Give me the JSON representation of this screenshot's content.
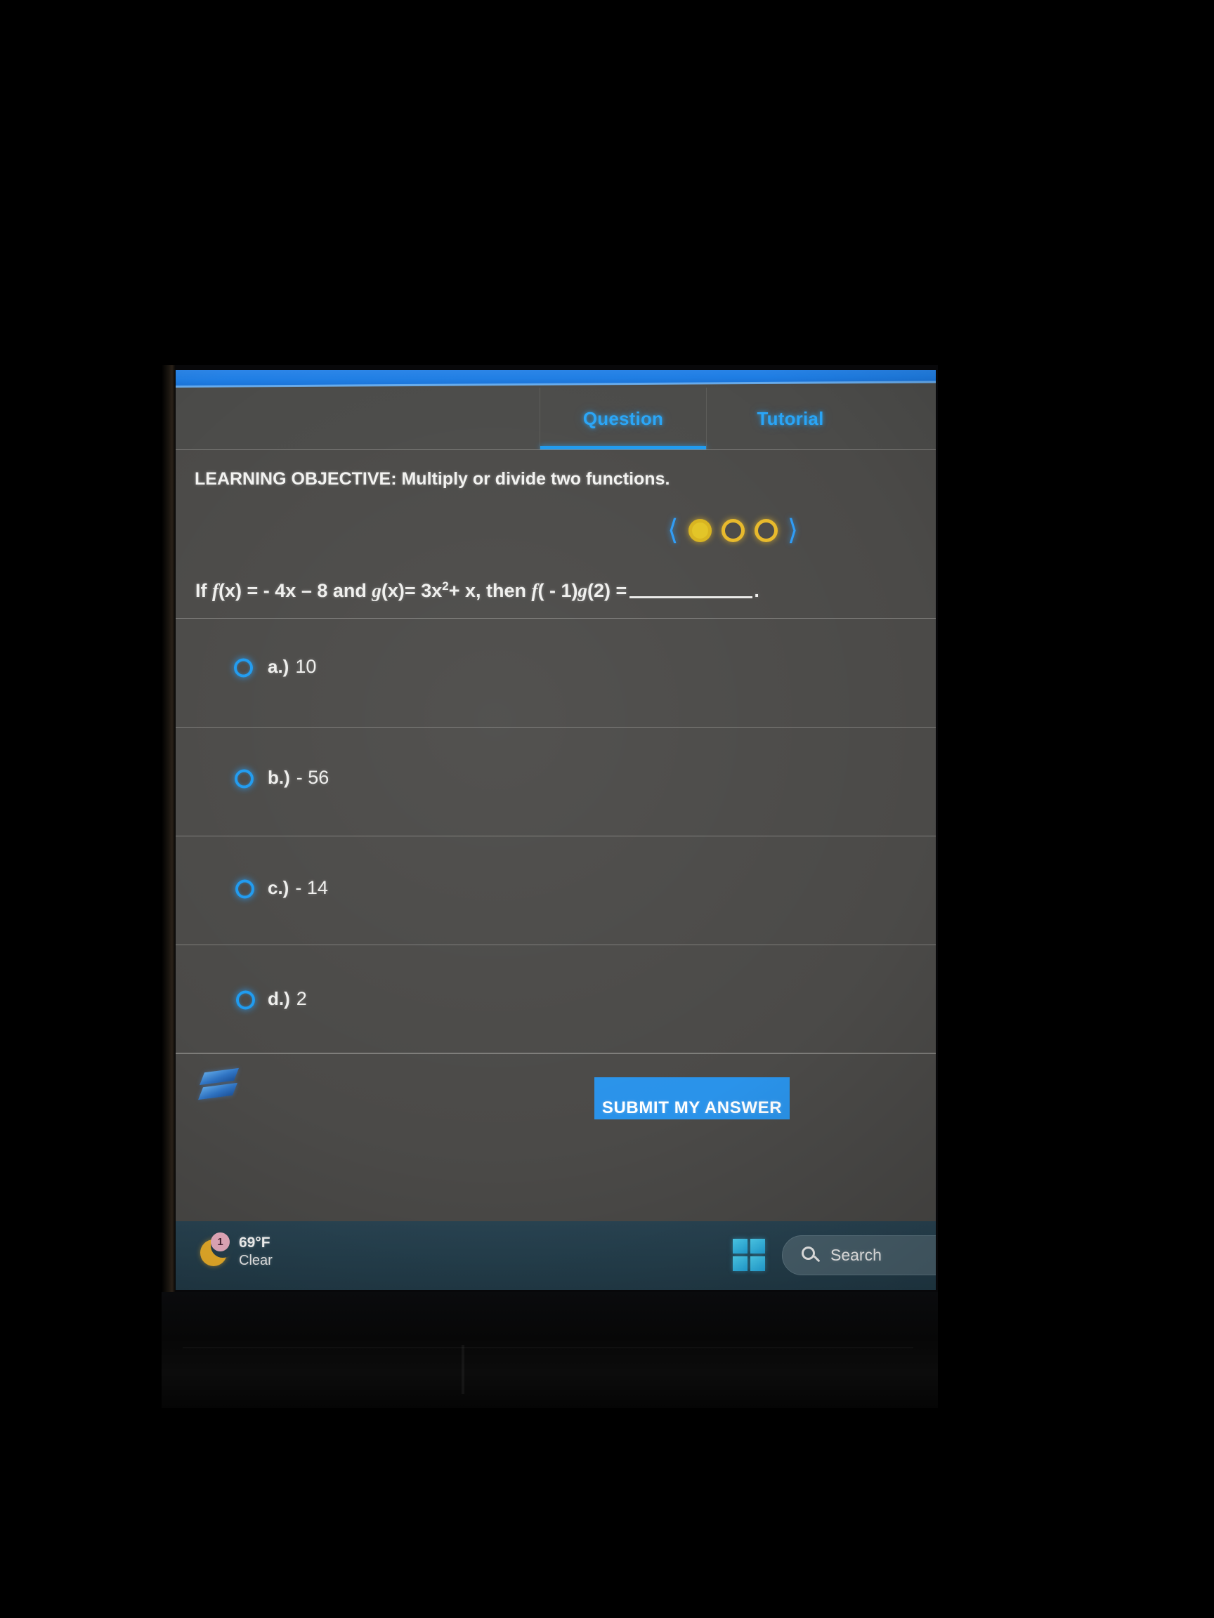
{
  "app": {
    "brand_logo": "sophia-s-logo",
    "accent_blue": "#2a93ea",
    "tab_active_color": "#29a5f7",
    "pager_color": "#e3c425"
  },
  "tabs": [
    {
      "label": "Question",
      "active": true
    },
    {
      "label": "Tutorial",
      "active": false
    }
  ],
  "objective": {
    "prefix": "LEARNING OBJECTIVE:",
    "text": "Multiply or divide two functions."
  },
  "pager": {
    "prev_icon": "chevron-left-icon",
    "next_icon": "chevron-right-icon",
    "total": 3,
    "current": 1,
    "states": [
      "filled",
      "hollow",
      "hollow"
    ]
  },
  "question": {
    "if_word": "If",
    "f_name": "f",
    "f_args": "(x)",
    "eq1": "= - 4x – 8",
    "and_word": "and",
    "g_name": "g",
    "g_args": "(x)",
    "eq2_base": "= 3x",
    "eq2_exp": "2",
    "eq2_tail": "+ x,",
    "then_word": "then",
    "expr_f": "f",
    "expr_f_arg": "( - 1)",
    "expr_g": "g",
    "expr_g_arg": "(2)",
    "equals": "=",
    "period": "."
  },
  "answers": [
    {
      "key": "a.)",
      "value": "10",
      "selected": false
    },
    {
      "key": "b.)",
      "value": "- 56",
      "selected": false
    },
    {
      "key": "c.)",
      "value": "- 14",
      "selected": false
    },
    {
      "key": "d.)",
      "value": "2",
      "selected": false
    }
  ],
  "footer": {
    "submit_label": "SUBMIT MY ANSWER"
  },
  "taskbar": {
    "weather": {
      "icon": "crescent-moon-icon",
      "badge": "1",
      "temperature": "69°F",
      "condition": "Clear"
    },
    "start": {
      "icon": "windows-start-icon"
    },
    "search": {
      "icon": "search-icon",
      "placeholder": "Search",
      "label": "Search"
    }
  }
}
